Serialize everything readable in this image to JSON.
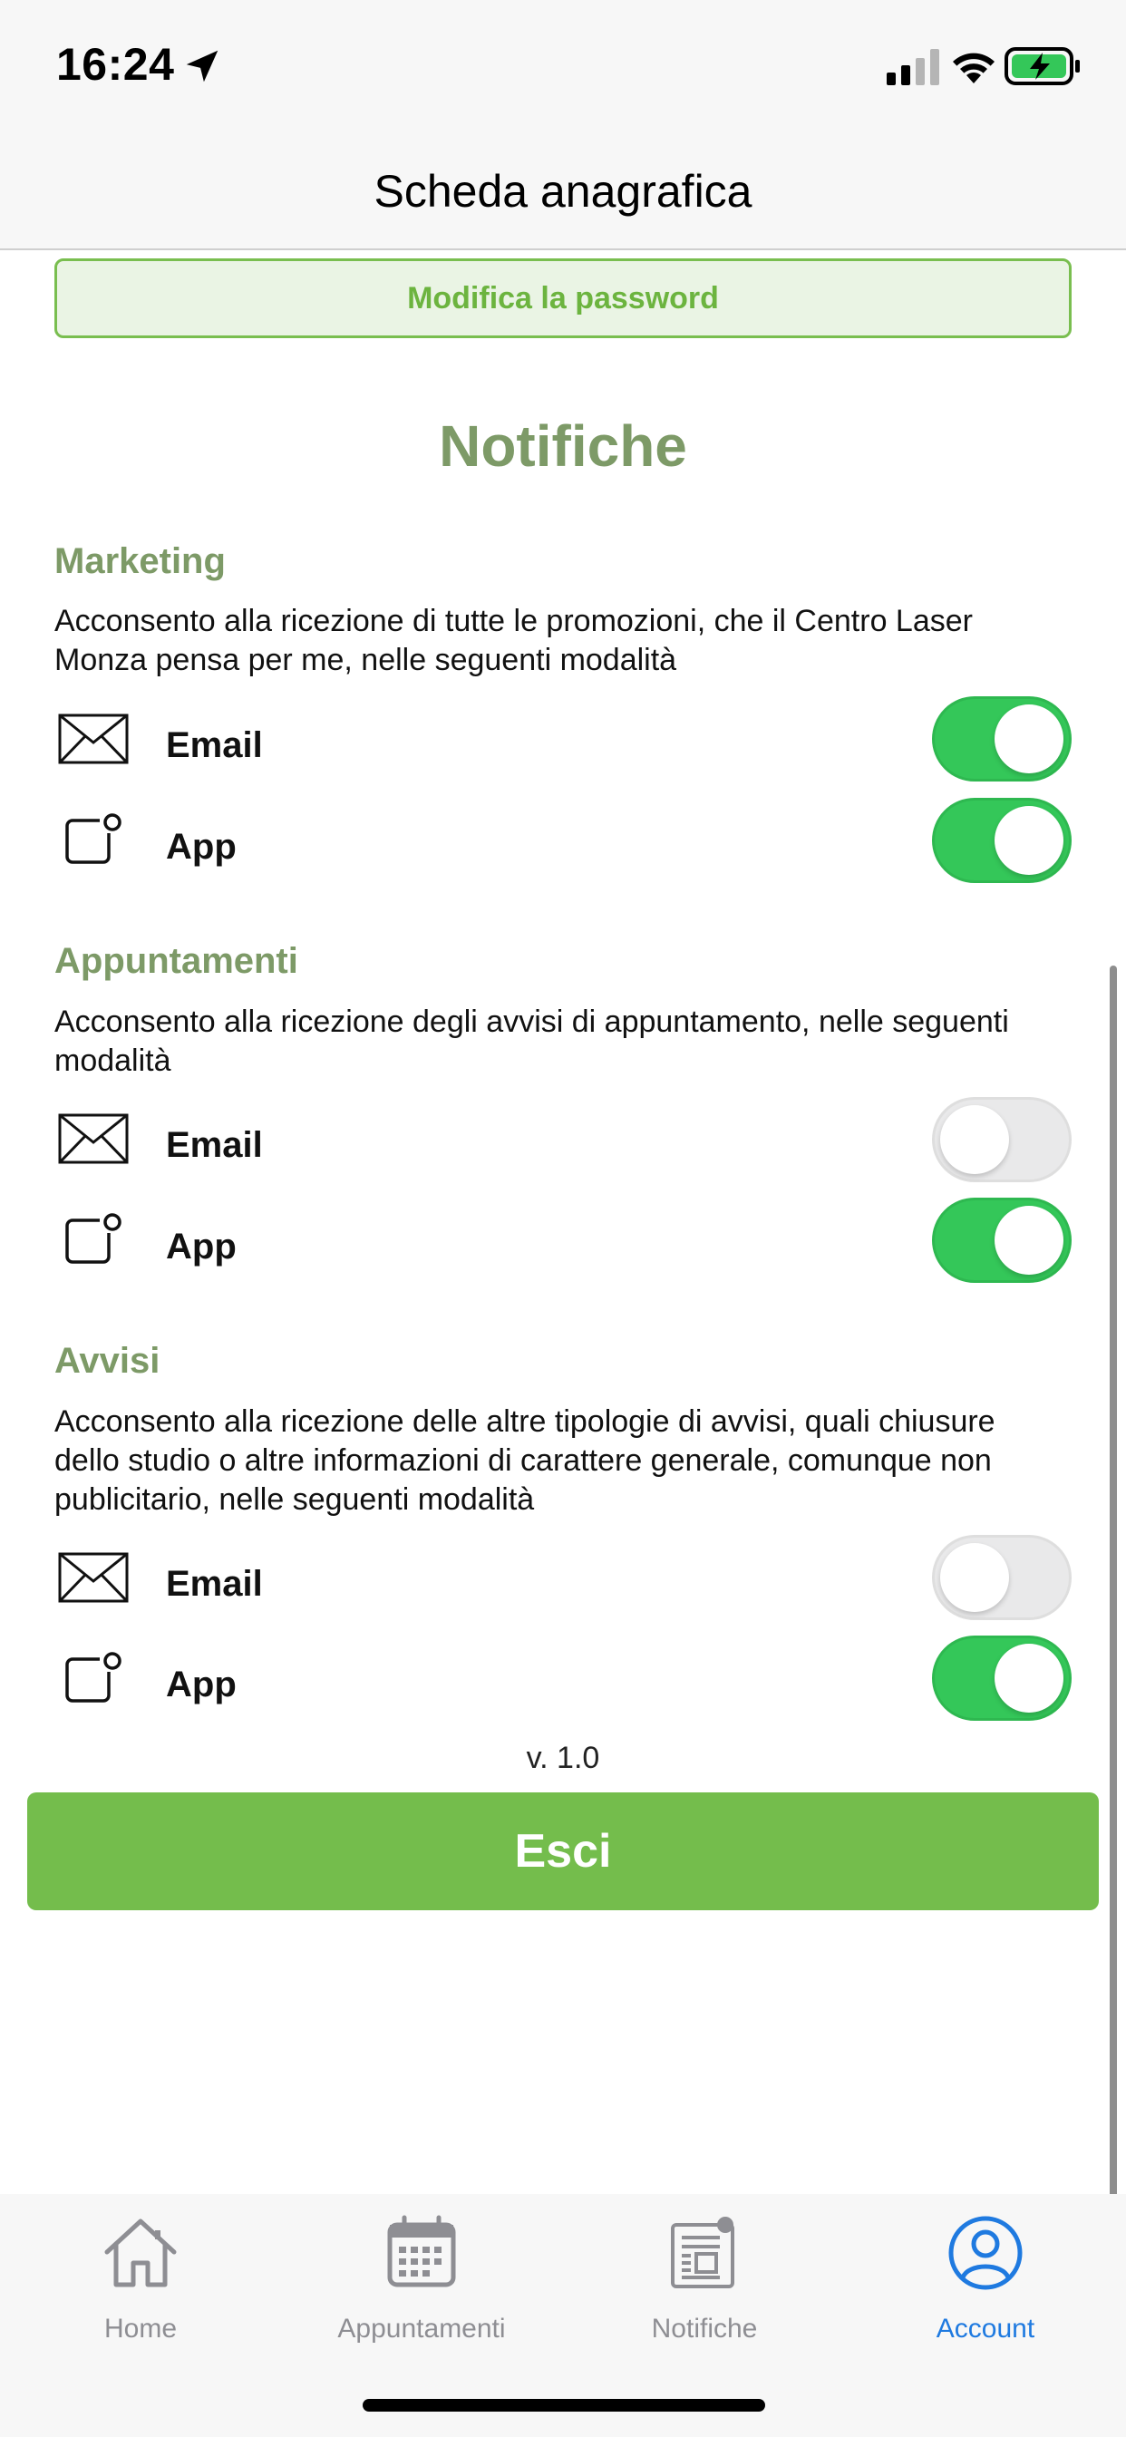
{
  "status_bar": {
    "time": "16:24",
    "icons": [
      "location-arrow-icon",
      "cellular-signal-icon",
      "wifi-icon",
      "battery-charging-icon"
    ]
  },
  "nav": {
    "title": "Scheda anagrafica"
  },
  "password_button": {
    "label": "Modifica la password"
  },
  "notifications": {
    "heading": "Notifiche",
    "groups": [
      {
        "title": "Marketing",
        "description": "Acconsento alla ricezione di tutte le promozioni, che il Centro Laser Monza pensa per me, nelle seguenti modalità",
        "rows": [
          {
            "label": "Email",
            "icon": "envelope-icon",
            "enabled": true
          },
          {
            "label": "App",
            "icon": "app-notification-icon",
            "enabled": true
          }
        ]
      },
      {
        "title": "Appuntamenti",
        "description": "Acconsento alla ricezione degli avvisi di appuntamento, nelle seguenti modalità",
        "rows": [
          {
            "label": "Email",
            "icon": "envelope-icon",
            "enabled": false
          },
          {
            "label": "App",
            "icon": "app-notification-icon",
            "enabled": true
          }
        ]
      },
      {
        "title": "Avvisi",
        "description": "Acconsento alla ricezione delle altre tipologie di avvisi, quali chiusure dello studio o altre informazioni di carattere generale, comunque non publicitario, nelle seguenti modalità",
        "rows": [
          {
            "label": "Email",
            "icon": "envelope-icon",
            "enabled": false
          },
          {
            "label": "App",
            "icon": "app-notification-icon",
            "enabled": true
          }
        ]
      }
    ]
  },
  "version": "v. 1.0",
  "logout_button": {
    "label": "Esci"
  },
  "tab_bar": {
    "tabs": [
      {
        "label": "Home",
        "icon": "house-icon",
        "active": false
      },
      {
        "label": "Appuntamenti",
        "icon": "calendar-icon",
        "active": false
      },
      {
        "label": "Notifiche",
        "icon": "newspaper-icon",
        "active": false
      },
      {
        "label": "Account",
        "icon": "user-circle-icon",
        "active": true
      }
    ]
  },
  "colors": {
    "accent_green": "#74bd4c",
    "heading_green": "#7d9a67",
    "toggle_on": "#34c759",
    "toggle_off": "#e9e9ea",
    "active_tab": "#1f7ae0",
    "inactive_tab": "#8e8e93"
  }
}
